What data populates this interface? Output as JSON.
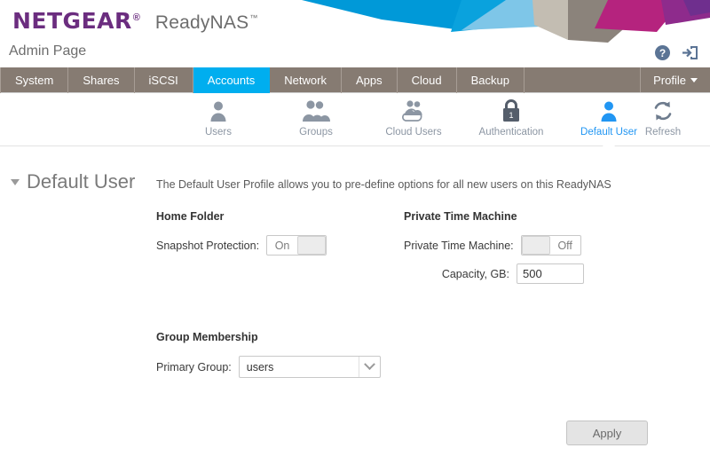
{
  "header": {
    "brand": "NETGEAR",
    "brand_mark": "®",
    "product": "ReadyNAS",
    "product_mark": "™",
    "admin_page": "Admin Page",
    "brand_color": "#6b2d7f",
    "tools": [
      {
        "name": "help-icon",
        "title": "Help"
      },
      {
        "name": "logout-icon",
        "title": "Log out"
      }
    ]
  },
  "tabs": {
    "items": [
      {
        "label": "System",
        "active": false
      },
      {
        "label": "Shares",
        "active": false
      },
      {
        "label": "iSCSI",
        "active": false
      },
      {
        "label": "Accounts",
        "active": true
      },
      {
        "label": "Network",
        "active": false
      },
      {
        "label": "Apps",
        "active": false
      },
      {
        "label": "Cloud",
        "active": false
      },
      {
        "label": "Backup",
        "active": false
      }
    ],
    "profile_label": "Profile",
    "active_color": "#00aeef",
    "bar_color": "#867b72"
  },
  "subnav": {
    "items": [
      {
        "label": "Users",
        "icon": "user-icon",
        "active": false
      },
      {
        "label": "Groups",
        "icon": "users-group-icon",
        "active": false
      },
      {
        "label": "Cloud Users",
        "icon": "cloud-users-icon",
        "active": false
      },
      {
        "label": "Authentication",
        "icon": "lock-icon",
        "active": false
      },
      {
        "label": "Default User",
        "icon": "default-user-icon",
        "active": true
      }
    ],
    "refresh_label": "Refresh",
    "active_color": "#2196f3",
    "inactive_color": "#8c96a3"
  },
  "section": {
    "title": "Default User",
    "description": "The Default User Profile allows you to pre-define options for all new users on this ReadyNAS"
  },
  "home_folder": {
    "title": "Home Folder",
    "snapshot_protection": {
      "label": "Snapshot Protection:",
      "value": "On",
      "state": "on"
    }
  },
  "private_time_machine": {
    "title": "Private Time Machine",
    "toggle": {
      "label": "Private Time Machine:",
      "value": "Off",
      "state": "off"
    },
    "capacity": {
      "label": "Capacity, GB:",
      "value": "500"
    }
  },
  "group_membership": {
    "title": "Group Membership",
    "primary_group": {
      "label": "Primary Group:",
      "value": "users"
    }
  },
  "footer": {
    "apply_label": "Apply"
  }
}
